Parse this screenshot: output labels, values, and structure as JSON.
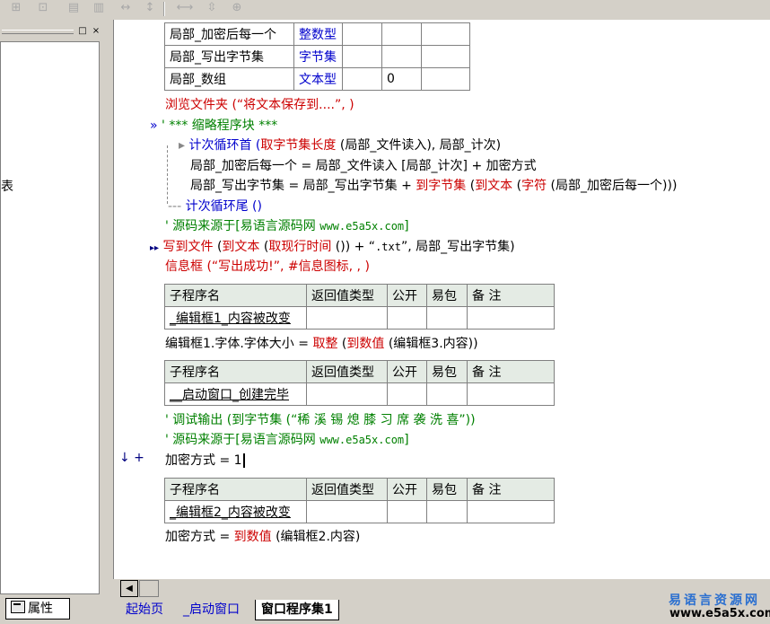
{
  "toolbar": {
    "icons": [
      "align-left-icon",
      "align-center-icon",
      "align-top-icon",
      "align-middle-icon",
      "space-horizontal-icon",
      "space-vertical-icon",
      "same-width-icon",
      "same-height-icon",
      "same-size-icon"
    ],
    "glyphs": [
      "⊞",
      "⊡",
      "▤",
      "▥",
      "↔",
      "↕",
      "⟷",
      "⇳",
      "⊕"
    ]
  },
  "left_panel": {
    "pin_label": "□",
    "close_label": "×",
    "body_text": "表",
    "properties_tab": "属性"
  },
  "var_table": {
    "rows": [
      {
        "name": "局部_加密后每一个",
        "type": "整数型",
        "c3": "",
        "c4": "",
        "c5": ""
      },
      {
        "name": "局部_写出字节集",
        "type": "字节集",
        "c3": "",
        "c4": "",
        "c5": ""
      },
      {
        "name": "局部_数组",
        "type": "文本型",
        "c3": "",
        "c4": "0",
        "c5": ""
      }
    ]
  },
  "code": {
    "line1": "浏览文件夹 (“将文本保存到....”, )",
    "line2_marker": "»",
    "line2": "' *** 缩略程序块 ***",
    "loop_head_a": "计次循环首 (",
    "loop_head_b": "取字节集长度",
    "loop_head_c": " (局部_文件读入), 局部_计次)",
    "loop_body1": "局部_加密后每一个 = 局部_文件读入 [局部_计次] + 加密方式",
    "loop_body2_a": "局部_写出字节集 = 局部_写出字节集 + ",
    "loop_body2_b": "到字节集",
    "loop_body2_c": " (",
    "loop_body2_d": "到文本",
    "loop_body2_e": " (",
    "loop_body2_f": "字符",
    "loop_body2_g": " (局部_加密后每一个)))",
    "loop_tail": "计次循环尾 ()",
    "comment_source1_a": "' 源码来源于[易语言源码网 ",
    "comment_source1_b": "www.e5a5x.com",
    "comment_source1_c": "]",
    "write_marker": "▸▸",
    "write_a": "写到文件",
    "write_b": " (",
    "write_c": "到文本",
    "write_d": " (",
    "write_e": "取现行时间",
    "write_f": " ()) + “",
    "write_g": ".txt",
    "write_h": "”, 局部_写出字节集)",
    "msg_a": "信息框",
    "msg_b": " (“写出成功!”, #信息图标, , )",
    "font_a": "编辑框1.字体.字体大小 = ",
    "font_b": "取整",
    "font_c": " (",
    "font_d": "到数值",
    "font_e": " (编辑框3.内容))",
    "debug_line": "' 调试输出 (到字节集 (“稀 溪 锡 熄 膝 习 席 袭 洗 喜”))",
    "comment_source2_a": "' 源码来源于[易语言源码网 ",
    "comment_source2_b": "www.e5a5x.com",
    "comment_source2_c": "]",
    "assign_marker": "↓ +",
    "assign_line": "加密方式 = 1",
    "last_a": "加密方式 = ",
    "last_b": "到数值",
    "last_c": " (编辑框2.内容)"
  },
  "sub_tables": [
    {
      "headers": [
        "子程序名",
        "返回值类型",
        "公开",
        "易包",
        "备 注"
      ],
      "name": "_编辑框1_内容被改变"
    },
    {
      "headers": [
        "子程序名",
        "返回值类型",
        "公开",
        "易包",
        "备 注"
      ],
      "name": "__启动窗口_创建完毕"
    },
    {
      "headers": [
        "子程序名",
        "返回值类型",
        "公开",
        "易包",
        "备 注"
      ],
      "name": "_编辑框2_内容被改变"
    }
  ],
  "scrollbar": {
    "left_arrow": "◀"
  },
  "tabs": [
    "起始页",
    "_启动窗口",
    "窗口程序集1"
  ],
  "watermark": {
    "cn": "易语言资源网",
    "url": "www.e5a5x.com"
  },
  "colors": {
    "keyword": "#cc0000",
    "type": "#0000cc",
    "comment": "#008000",
    "header_bg": "#e4ebe4"
  }
}
